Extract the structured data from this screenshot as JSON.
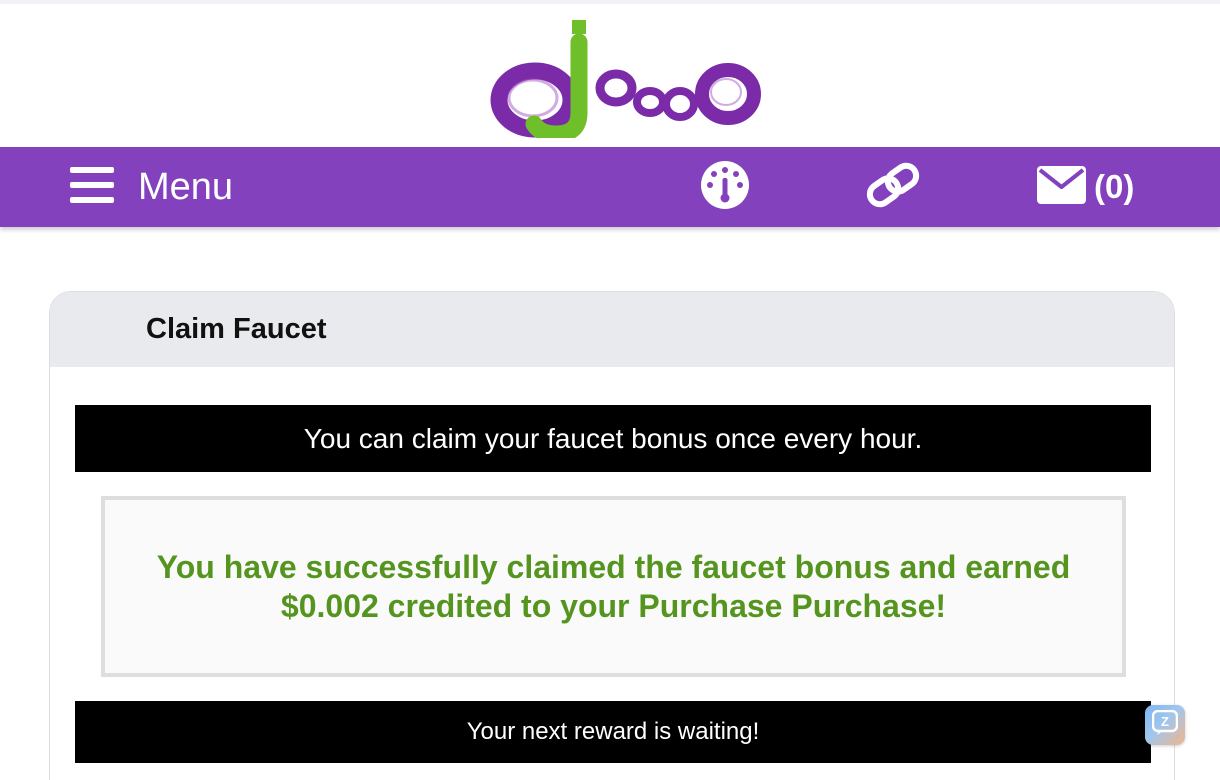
{
  "colors": {
    "accent": "#8441bd",
    "success": "#55951f",
    "logo_purple": "#7b2aa8",
    "logo_green": "#6fbf2a"
  },
  "header": {
    "logo_alt": "Ojooo",
    "logo_icon": "ojooo-logo"
  },
  "navbar": {
    "menu_label": "Menu",
    "menu_icon": "hamburger-icon",
    "dashboard_icon": "dashboard-icon",
    "link_icon": "link-icon",
    "messages_icon": "envelope-icon",
    "messages_count": "(0)"
  },
  "card": {
    "title": "Claim Faucet",
    "info_banner": "You can claim your faucet bonus once every hour.",
    "success_message": "You have successfully claimed the faucet bonus and earned $0.002 credited to your Purchase Purchase!",
    "footer_banner": "Your next reward is waiting!"
  },
  "chat_widget": {
    "icon": "chat-icon",
    "letter": "Z"
  }
}
